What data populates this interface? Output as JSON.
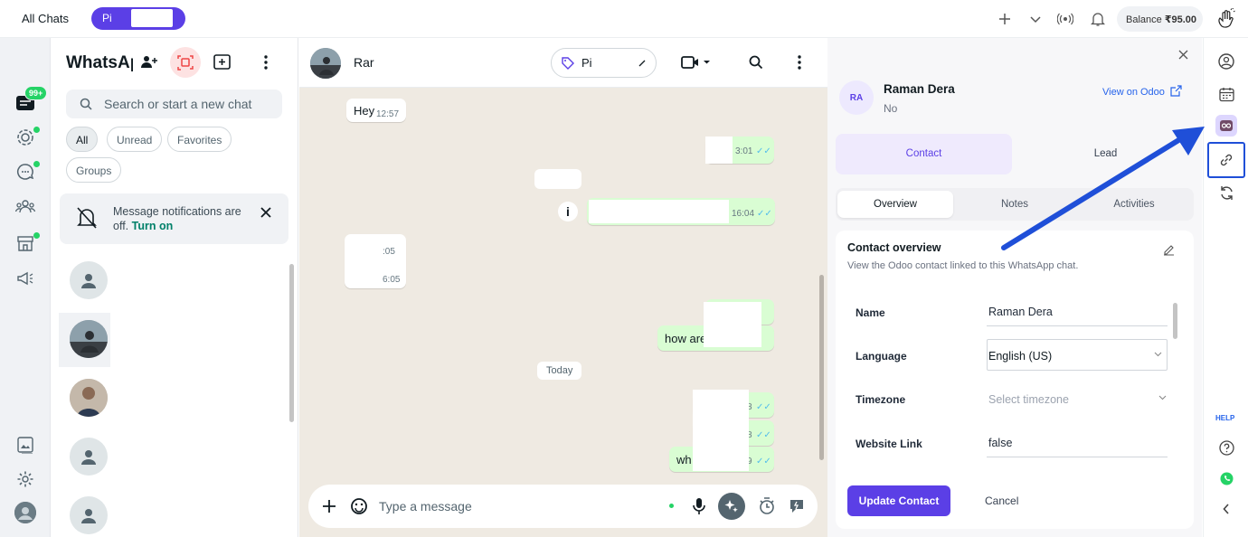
{
  "top_bar": {
    "all_chats": "All Chats",
    "pill_label": "Pi",
    "balance_label": "Balance",
    "balance_value": "₹95.00"
  },
  "rail": {
    "badge": "99+"
  },
  "chat_list": {
    "title": "WhatsAp",
    "search_placeholder": "Search or start a new chat",
    "filters": [
      "All",
      "Unread",
      "Favorites",
      "Groups"
    ],
    "notification": {
      "text": "Message notifications are off.",
      "link": "Turn on"
    }
  },
  "conversation": {
    "contact_name": "Rar",
    "tag_label": "Pi",
    "messages": [
      {
        "text": "Hey",
        "time": "12:57"
      },
      {
        "time": "3:01"
      },
      {
        "time": "16:04"
      },
      {
        "time": ":05"
      },
      {
        "time": "6:05"
      },
      {
        "text": "how are"
      },
      {
        "time": "8"
      },
      {
        "time": "8"
      },
      {
        "text": "wh",
        "time": "9"
      }
    ],
    "date_divider": "Today",
    "composer_placeholder": "Type a message"
  },
  "contact_panel": {
    "avatar_initials": "RA",
    "name": "Raman Dera",
    "subtitle": "No",
    "view_link": "View on Odoo",
    "tabs": [
      "Contact",
      "Lead"
    ],
    "subtabs": [
      "Overview",
      "Notes",
      "Activities"
    ],
    "section_title": "Contact overview",
    "section_desc": "View the Odoo contact linked to this WhatsApp chat.",
    "fields": [
      {
        "label": "Name",
        "value": "Raman Dera"
      },
      {
        "label": "Language",
        "value": "English (US)"
      },
      {
        "label": "Timezone",
        "value": "Select timezone"
      },
      {
        "label": "Website Link",
        "value": "false"
      }
    ],
    "update_button": "Update Contact",
    "cancel_button": "Cancel"
  },
  "right_bar": {
    "help": "HELP"
  },
  "colors": {
    "brand_purple": "#5b3fe6",
    "whatsapp_green": "#25d366",
    "outgoing_bubble": "#d9fdd3",
    "arrow_blue": "#1f4fd8",
    "link_blue": "#2563eb"
  }
}
